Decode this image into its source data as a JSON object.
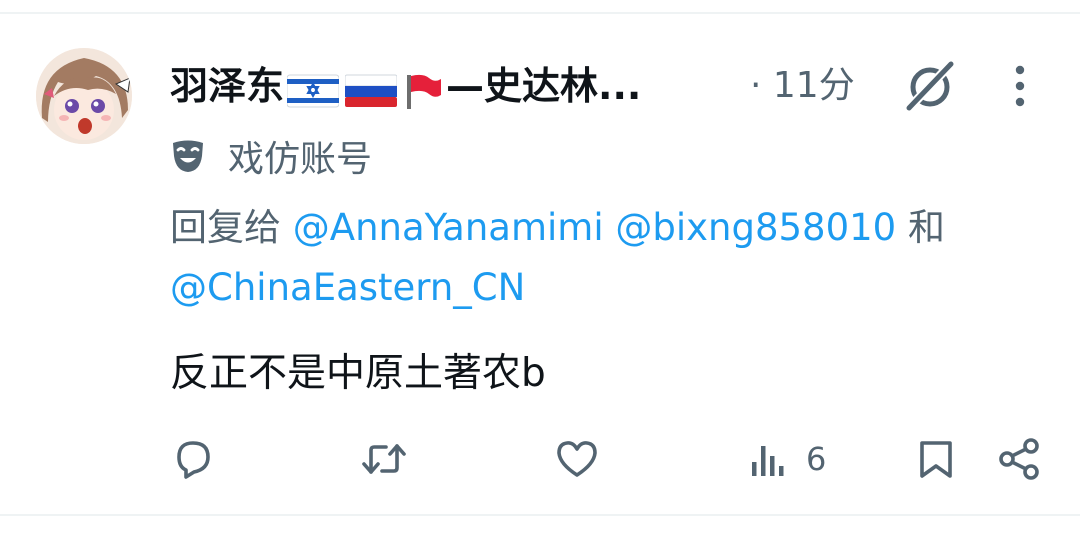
{
  "tweet": {
    "author_display_name_part1": "羽泽东",
    "author_display_name_part2": "—史达林...",
    "time_label": "· 11分",
    "account_label": "戏仿账号",
    "reply_prefix": "回复给 ",
    "reply_conjunction": " 和 ",
    "reply_mentions": [
      "@AnnaYanamimi",
      "@bixng858010",
      "@ChinaEastern_CN"
    ],
    "text": "反正不是中原土著农b",
    "views_count": "6"
  },
  "icons": {
    "reply": "reply-icon",
    "retweet": "retweet-icon",
    "like": "like-icon",
    "views": "views-icon",
    "bookmark": "bookmark-icon",
    "share": "share-icon",
    "grok": "grok-icon",
    "more": "more-icon",
    "parody": "parody-mask-icon"
  },
  "colors": {
    "link": "#1d9bf0",
    "secondary_text": "#536471",
    "primary_text": "#0f1419",
    "divider": "#eff3f4"
  }
}
